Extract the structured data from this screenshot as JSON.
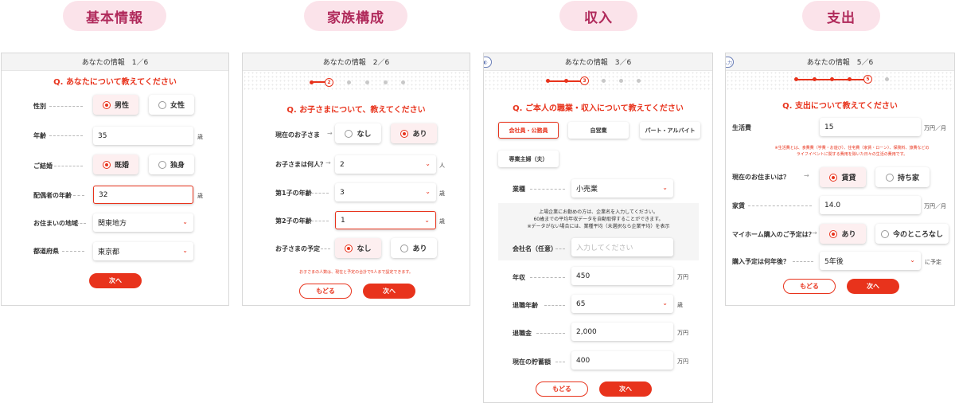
{
  "sections": [
    "基本情報",
    "家族構成",
    "収入",
    "支出"
  ],
  "p1": {
    "header": "あなたの情報　1／6",
    "question": "Q. あなたについて教えてください",
    "gender_label": "性別",
    "gender_male": "男性",
    "gender_female": "女性",
    "age_label": "年齢",
    "age_value": "35",
    "age_unit": "歳",
    "married_label": "ご結婚",
    "married_yes": "既婚",
    "married_no": "独身",
    "spouse_age_label": "配偶者の年齢",
    "spouse_age_value": "32",
    "spouse_age_unit": "歳",
    "region_label": "お住まいの地域",
    "region_value": "関東地方",
    "pref_label": "都道府県",
    "pref_value": "東京都",
    "next": "次へ"
  },
  "p2": {
    "header": "あなたの情報　2／6",
    "step": "2",
    "question": "Q. お子さまについて、教えてください",
    "children_label": "現在のお子さま",
    "children_none": "なし",
    "children_yes": "あり",
    "count_label": "お子さまは何人？",
    "count_value": "2",
    "count_unit": "人",
    "child1_label": "第1子の年齢",
    "child1_value": "3",
    "child1_unit": "歳",
    "child2_label": "第2子の年齢",
    "child2_value": "1",
    "child2_unit": "歳",
    "plan_label": "お子さまの予定",
    "plan_none": "なし",
    "plan_yes": "あり",
    "note": "お子さまの人数は、現在と予定の合計で5人まで設定できます。",
    "back": "もどる",
    "next": "次へ"
  },
  "p3": {
    "header": "あなたの情報　3／6",
    "step": "3",
    "question": "Q. ご本人の職業・収入について教えてください",
    "job_types": [
      "会社員・公務員",
      "自営業",
      "パート・アルバイト",
      "専業主婦（夫）"
    ],
    "industry_label": "業種",
    "industry_value": "小売業",
    "info_lines": [
      "上場企業にお勤めの方は、企業名を入力してください。",
      "60歳までの平均年収データを自動取得することができます。",
      "※データがない場合には、業種平均（未選択なら企業平均）を表示"
    ],
    "company_label": "会社名（任意）",
    "company_placeholder": "入力してください",
    "income_label": "年収",
    "income_value": "450",
    "income_unit": "万円",
    "retire_age_label": "退職年齢",
    "retire_age_value": "65",
    "retire_age_unit": "歳",
    "retire_money_label": "退職金",
    "retire_money_value": "2,000",
    "retire_money_unit": "万円",
    "savings_label": "現在の貯蓄額",
    "savings_value": "400",
    "savings_unit": "万円",
    "back": "もどる",
    "next": "次へ"
  },
  "p4": {
    "header": "あなたの情報　5／6",
    "step": "5",
    "edge_tab": "入力",
    "question": "Q. 支出について教えてください",
    "living_label": "生活費",
    "living_value": "15",
    "living_unit": "万円／月",
    "note_lines": [
      "※生活費とは、食費費（学費・お遊び）、住宅費（家賃・ローン）、保険料、旅費などの",
      "ライフイベントに関する費用を除いた日々の生活の費用です。"
    ],
    "housing_label": "現在のお住まいは？",
    "housing_rent": "賃貸",
    "housing_own": "持ち家",
    "rent_label": "家賃",
    "rent_value": "14.0",
    "rent_unit": "万円／月",
    "buy_label": "マイホーム購入のご予定は？",
    "buy_yes": "あり",
    "buy_no": "今のところなし",
    "when_label": "購入予定は何年後？",
    "when_value": "5年後",
    "when_unit": "に予定",
    "back": "もどる",
    "next": "次へ"
  },
  "icons": {
    "select": "chevron-down-icon",
    "radio": "radio-icon"
  },
  "colors": {
    "accent": "#e8331c",
    "pill_bg": "#fbe3ea",
    "pill_text": "#b02a5b"
  }
}
